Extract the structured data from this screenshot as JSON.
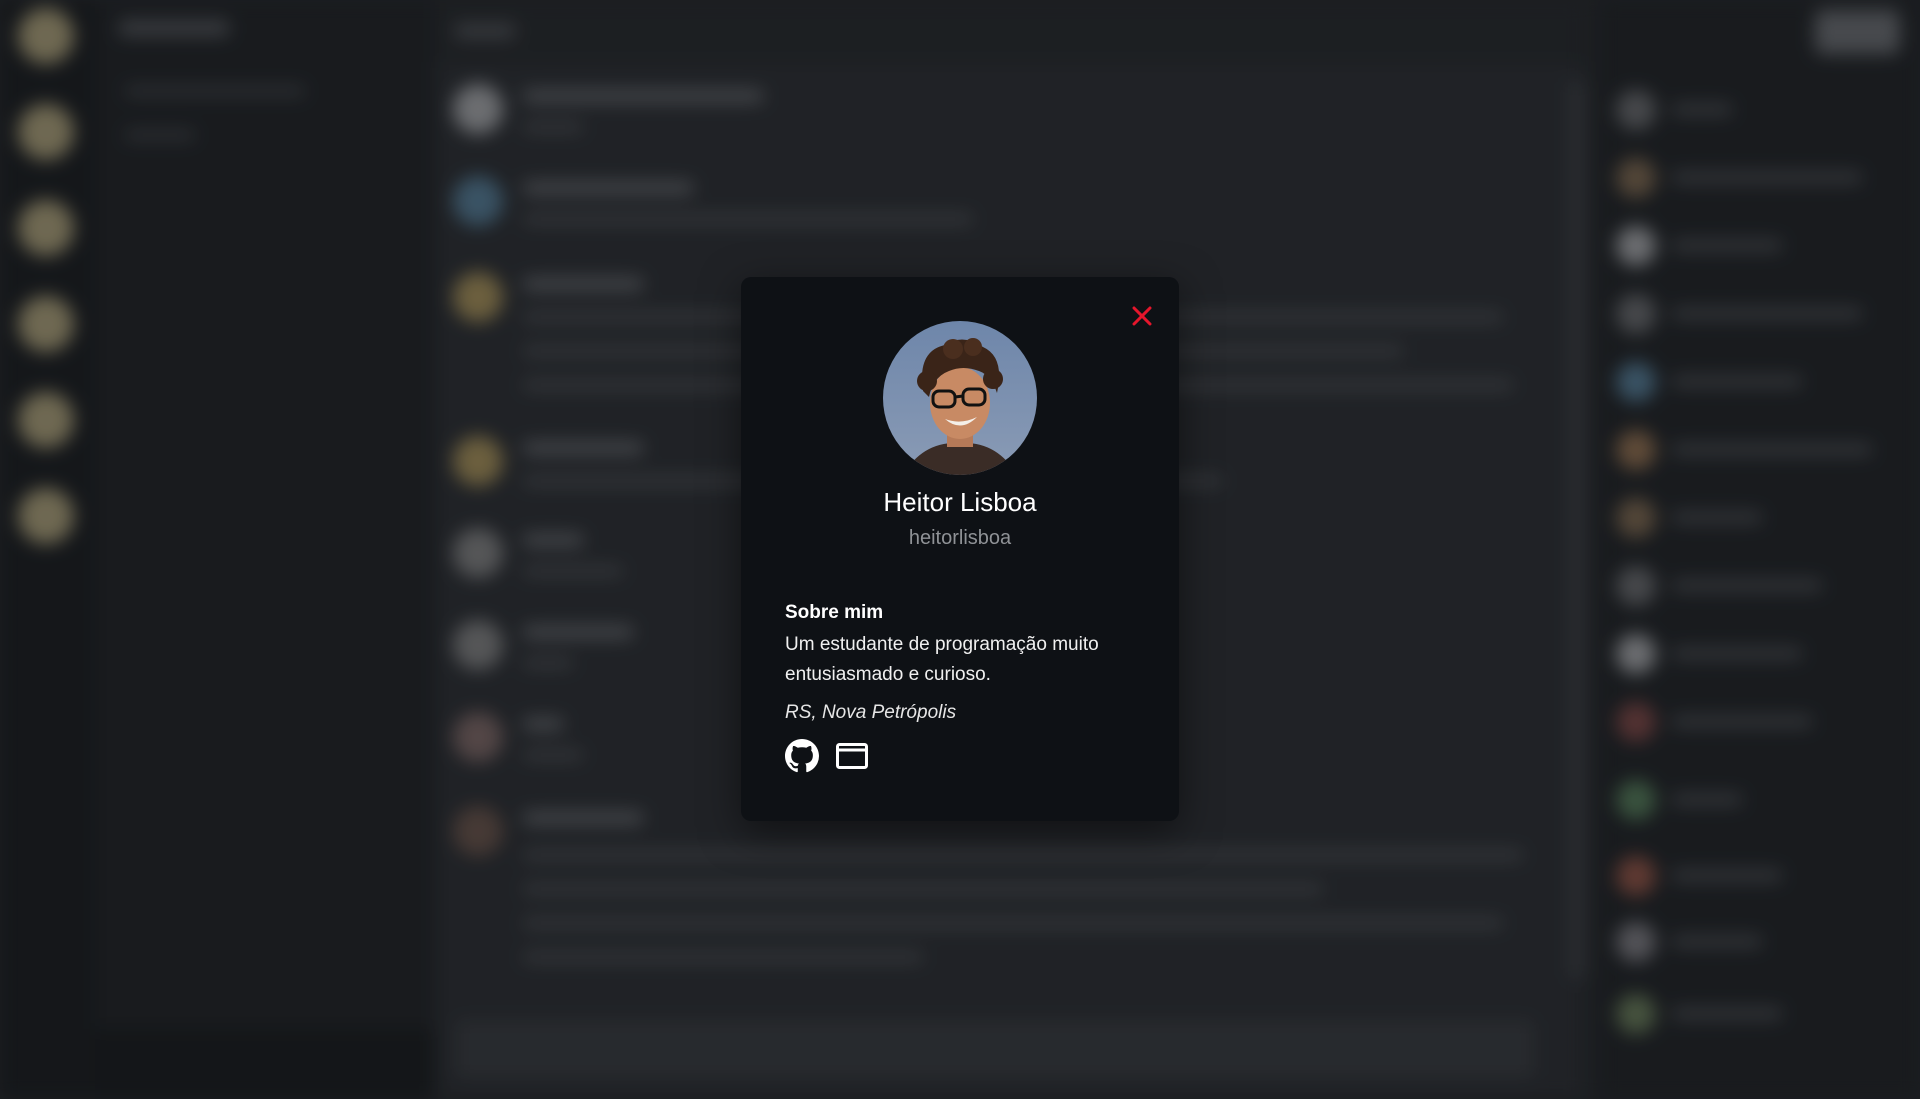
{
  "profile": {
    "name": "Heitor Lisboa",
    "username": "heitorlisboa",
    "about_title": "Sobre mim",
    "about_text": "Um estudante de programação muito entusiasmado e curioso.",
    "location": "RS, Nova Petrópolis",
    "links": [
      {
        "icon": "github-icon"
      },
      {
        "icon": "browser-window-icon"
      }
    ]
  },
  "colors": {
    "modal_bg": "#0e1115",
    "close": "#e5162c",
    "text": "#ffffff",
    "muted": "#8f9296"
  }
}
